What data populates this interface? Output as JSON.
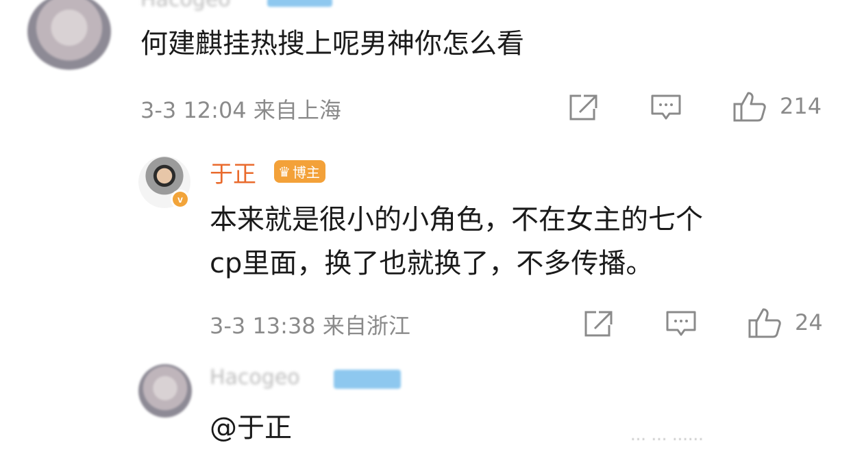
{
  "comments": [
    {
      "text": "何建麒挂热搜上呢男神你怎么看",
      "time": "3-3 12:04",
      "location": "来自上海",
      "like_count": "214"
    },
    {
      "author": "于正",
      "badge": "博主",
      "text_line1": "本来就是很小的小角色，不在女主的七个",
      "text_line2": "cp里面，换了也就换了，不多传播。",
      "time": "3-3 13:38",
      "location": "来自浙江",
      "like_count": "24"
    },
    {
      "text": "@于正"
    }
  ],
  "icons": {
    "share": "share-icon",
    "comment": "comment-icon",
    "like": "thumbs-up-icon"
  },
  "colors": {
    "blogger_name": "#e96a2c",
    "blogger_badge": "#f3a139",
    "verified_badge": "#f2a43a"
  }
}
